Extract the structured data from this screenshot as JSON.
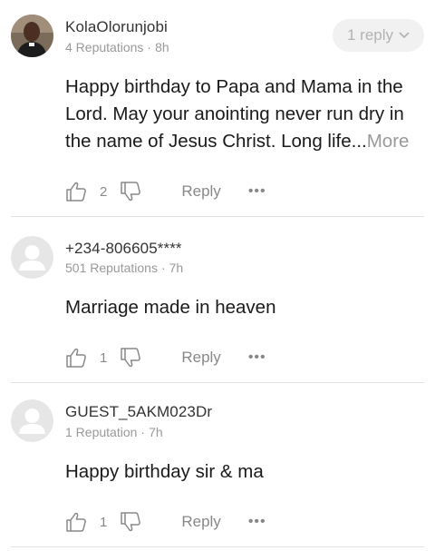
{
  "comments": [
    {
      "user": "KolaOlorunjobi",
      "reputation": "4 Reputations",
      "time": "8h",
      "replies": "1 reply",
      "text": "Happy birthday to Papa and Mama in the Lord. May your anointing never run dry in the name of Jesus Christ. Long life...",
      "more": "More",
      "likes": "2",
      "reply_label": "Reply",
      "avatar": "user-photo"
    },
    {
      "user": "+234-806605****",
      "reputation": "501 Reputations",
      "time": "7h",
      "text": "Marriage made in heaven",
      "likes": "1",
      "reply_label": "Reply",
      "avatar": "default-avatar-icon"
    },
    {
      "user": "GUEST_5AKM023Dr",
      "reputation": "1 Reputation",
      "time": "7h",
      "text": "Happy birthday sir & ma",
      "likes": "1",
      "reply_label": "Reply",
      "avatar": "default-avatar-icon"
    }
  ],
  "separator": "·",
  "more_icon": "•••"
}
